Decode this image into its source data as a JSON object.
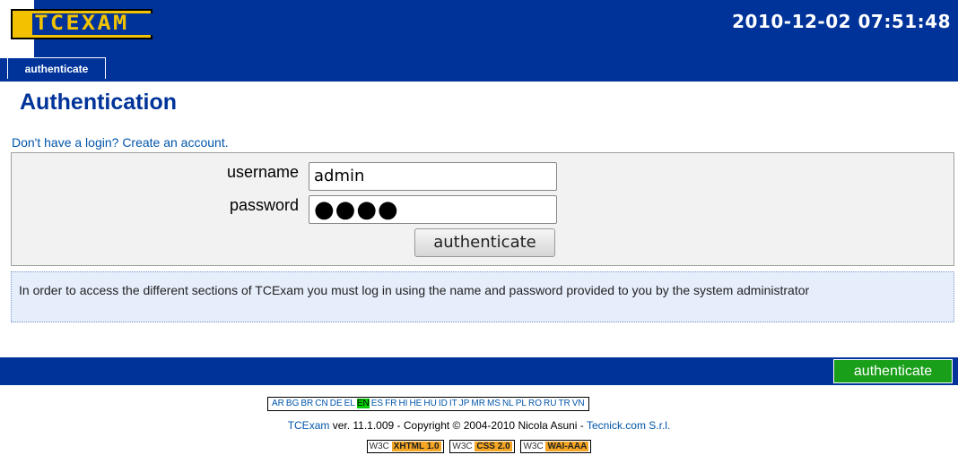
{
  "header": {
    "logo_text": "TCEXAM",
    "datetime": "2010-12-02 07:51:48",
    "tab_label": "authenticate"
  },
  "main": {
    "title": "Authentication",
    "register_link": "Don't have a login? Create an account.",
    "username_label": "username",
    "username_value": "admin",
    "password_label": "password",
    "password_masked": "●●●●",
    "submit_label": "authenticate",
    "info_text": "In order to access the different sections of TCExam you must log in using the name and password provided to you by the system administrator"
  },
  "footer": {
    "button_label": "authenticate",
    "languages": [
      "AR",
      "BG",
      "BR",
      "CN",
      "DE",
      "EL",
      "EN",
      "ES",
      "FR",
      "HI",
      "HE",
      "HU",
      "ID",
      "IT",
      "JP",
      "MR",
      "MS",
      "NL",
      "PL",
      "RO",
      "RU",
      "TR",
      "VN"
    ],
    "active_language": "EN",
    "copyright_app": "TCExam",
    "copyright_text": " ver. 11.1.009 - Copyright © 2004-2010 Nicola Asuni - ",
    "copyright_company": "Tecnick.com S.r.l.",
    "w3c_badges": [
      {
        "prefix": "W3C",
        "label": "XHTML 1.0"
      },
      {
        "prefix": "W3C",
        "label": "CSS 2.0"
      },
      {
        "prefix": "W3C",
        "label": "WAI-AAA"
      }
    ]
  },
  "colors": {
    "brand_blue": "#003399",
    "logo_yellow": "#f2c200",
    "active_green": "#1a9f1a"
  }
}
